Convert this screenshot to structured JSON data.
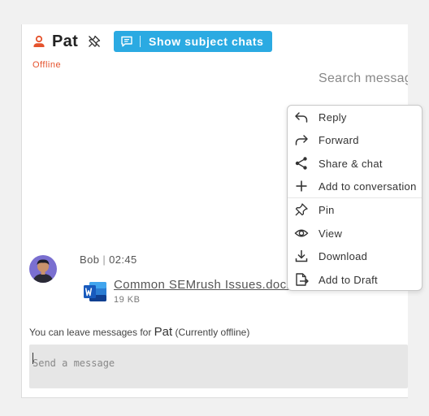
{
  "header": {
    "name": "Pat",
    "subject_chats_label": "Show subject chats",
    "status": "Offline"
  },
  "search": {
    "placeholder": "Search messages"
  },
  "message": {
    "sender": "Bob",
    "time": "02:45",
    "file_name": "Common SEMrush Issues.docx",
    "file_size": "19 KB"
  },
  "notice": {
    "prefix": "You can leave messages for",
    "name": "Pat",
    "suffix": "(Currently offline)"
  },
  "composer": {
    "placeholder": "Send a message"
  },
  "context_menu": {
    "items": [
      {
        "label": "Reply",
        "icon": "reply-icon"
      },
      {
        "label": "Forward",
        "icon": "forward-icon"
      },
      {
        "label": "Share & chat",
        "icon": "share-icon"
      },
      {
        "label": "Add to conversation",
        "icon": "plus-icon"
      },
      {
        "label": "Pin",
        "icon": "pin-icon"
      },
      {
        "label": "View",
        "icon": "eye-icon"
      },
      {
        "label": "Download",
        "icon": "download-icon"
      },
      {
        "label": "Add to Draft",
        "icon": "draft-icon"
      }
    ]
  },
  "colors": {
    "accent": "#2baae2",
    "status_offline": "#e5532d",
    "word_blue": "#185abd"
  }
}
